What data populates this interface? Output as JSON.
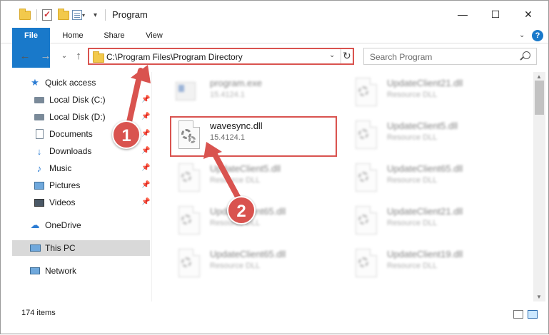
{
  "window": {
    "title": "Program",
    "minimize": "—",
    "maximize": "☐",
    "close": "✕"
  },
  "ribbon": {
    "file": "File",
    "home": "Home",
    "share": "Share",
    "view": "View",
    "help": "?"
  },
  "navigation": {
    "address": "C:\\Program Files\\Program Directory",
    "search_placeholder": "Search Program"
  },
  "sidebar": {
    "quick_access": "Quick access",
    "items": [
      {
        "label": "Local Disk (C:)",
        "icon": "drive-icon",
        "pinned": true
      },
      {
        "label": "Local Disk (D:)",
        "icon": "drive-icon",
        "pinned": true
      },
      {
        "label": "Documents",
        "icon": "documents-icon",
        "pinned": true
      },
      {
        "label": "Downloads",
        "icon": "downloads-icon",
        "pinned": true
      },
      {
        "label": "Music",
        "icon": "music-icon",
        "pinned": true
      },
      {
        "label": "Pictures",
        "icon": "pictures-icon",
        "pinned": true
      },
      {
        "label": "Videos",
        "icon": "videos-icon",
        "pinned": true
      }
    ],
    "onedrive": "OneDrive",
    "this_pc": "This PC",
    "network": "Network"
  },
  "files": [
    {
      "name": "program.exe",
      "sub": "15.4124.1",
      "type": "exe",
      "blurred": true
    },
    {
      "name": "UpdateClient21.dll",
      "sub": "Resource DLL",
      "type": "dll",
      "blurred": true
    },
    {
      "name": "wavesync.dll",
      "sub": "15.4124.1",
      "type": "dll",
      "blurred": false
    },
    {
      "name": "UpdateClient5.dll",
      "sub": "Resource DLL",
      "type": "dll",
      "blurred": true
    },
    {
      "name": "UpdateClient5.dll",
      "sub": "Resource DLL",
      "type": "dll",
      "blurred": true
    },
    {
      "name": "UpdateClient65.dll",
      "sub": "Resource DLL",
      "type": "dll",
      "blurred": true
    },
    {
      "name": "UpdateClient65.dll",
      "sub": "Resource DLL",
      "type": "dll",
      "blurred": true
    },
    {
      "name": "UpdateClient21.dll",
      "sub": "Resource DLL",
      "type": "dll",
      "blurred": true
    },
    {
      "name": "UpdateClient65.dll",
      "sub": "Resource DLL",
      "type": "dll",
      "blurred": true
    },
    {
      "name": "UpdateClient19.dll",
      "sub": "Resource DLL",
      "type": "dll",
      "blurred": true
    }
  ],
  "status": {
    "count": "174 items"
  },
  "annotations": {
    "step1": "1",
    "step2": "2",
    "color": "#d9534f"
  }
}
